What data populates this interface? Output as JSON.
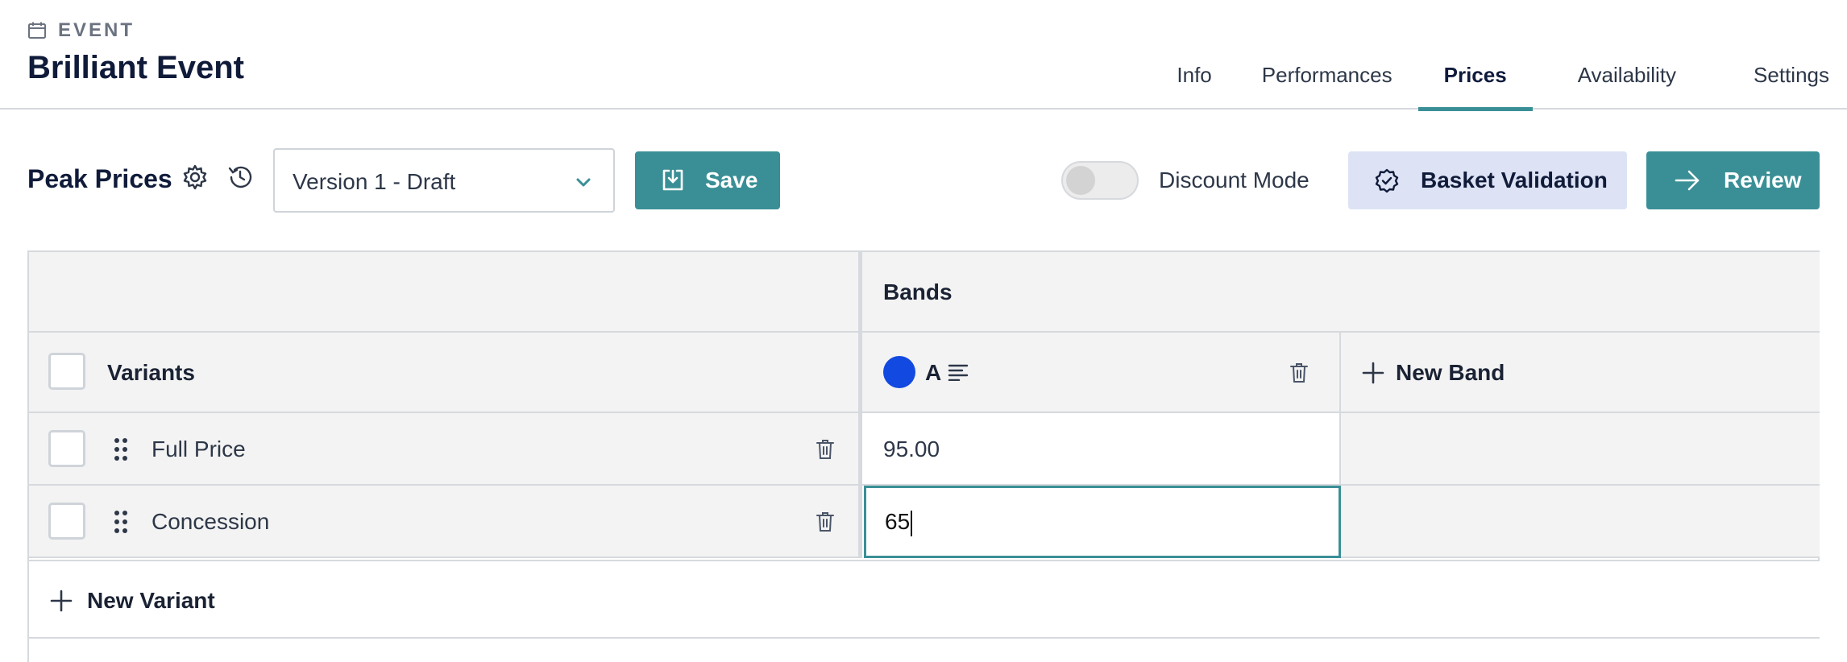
{
  "header": {
    "eyebrow": "EVENT",
    "title": "Brilliant Event",
    "tabs": [
      {
        "label": "Info",
        "active": false
      },
      {
        "label": "Performances",
        "active": false
      },
      {
        "label": "Prices",
        "active": true
      },
      {
        "label": "Availability",
        "active": false
      },
      {
        "label": "Settings",
        "active": false
      }
    ]
  },
  "toolbar": {
    "title": "Peak Prices",
    "settings_icon": "gear-icon",
    "history_icon": "history-icon",
    "version_select": {
      "value": "Version 1 - Draft"
    },
    "save_label": "Save",
    "discount_mode_label": "Discount Mode",
    "discount_mode_on": false,
    "basket_validation_label": "Basket Validation",
    "review_label": "Review"
  },
  "grid": {
    "bands_header": "Bands",
    "variants_header": "Variants",
    "bands": [
      {
        "name": "A",
        "color": "#1249e0"
      }
    ],
    "new_band_label": "New Band",
    "variants": [
      {
        "name": "Full Price",
        "prices": [
          "95.00"
        ]
      },
      {
        "name": "Concession",
        "prices": [
          "65"
        ]
      }
    ],
    "new_variant_label": "New Variant"
  },
  "colors": {
    "accent": "#3a8f96",
    "title": "#101b3a",
    "band_a": "#1249e0",
    "basket_bg": "#dde3f4"
  }
}
